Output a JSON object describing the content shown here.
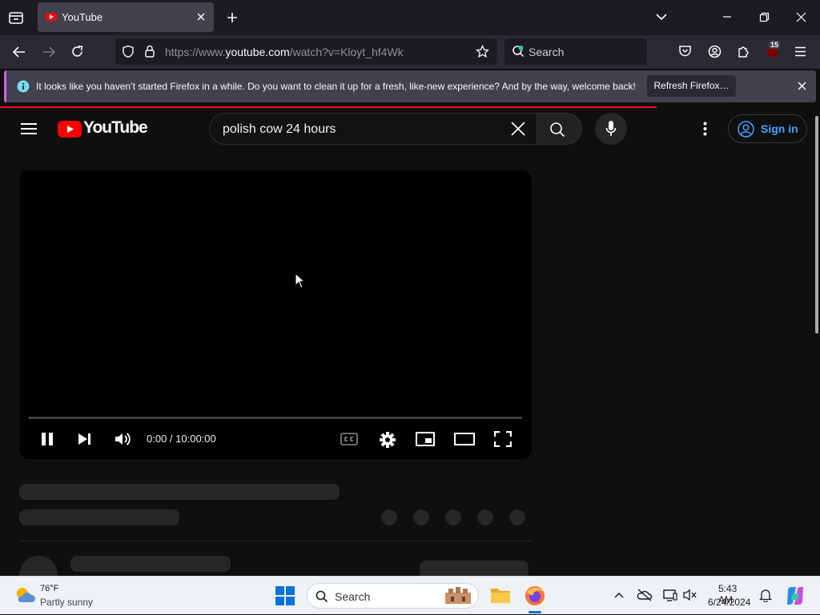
{
  "browser": {
    "tab_title": "YouTube",
    "url_prefix": "https://www.",
    "url_domain": "youtube.com",
    "url_path": "/watch?v=Kloyt_hf4Wk",
    "search_placeholder": "Search",
    "extension_badge": "15"
  },
  "notification": {
    "message": "It looks like you haven’t started Firefox in a while. Do you want to clean it up for a fresh, like-new experience? And by the way, welcome back!",
    "button": "Refresh Firefox…"
  },
  "youtube": {
    "logo_text": "YouTube",
    "search_query": "polish cow 24 hours",
    "sign_in": "Sign in",
    "player": {
      "time": "0:00 / 10:00:00",
      "progress": 0
    }
  },
  "taskbar": {
    "weather_temp": "76°F",
    "weather_condition": "Partly sunny",
    "search_label": "Search",
    "time": "5:43 AM",
    "date": "6/24/2024"
  },
  "colors": {
    "youtube_red": "#ff0000",
    "link_blue": "#3ea6ff",
    "notification_accent": "#cb67df"
  }
}
